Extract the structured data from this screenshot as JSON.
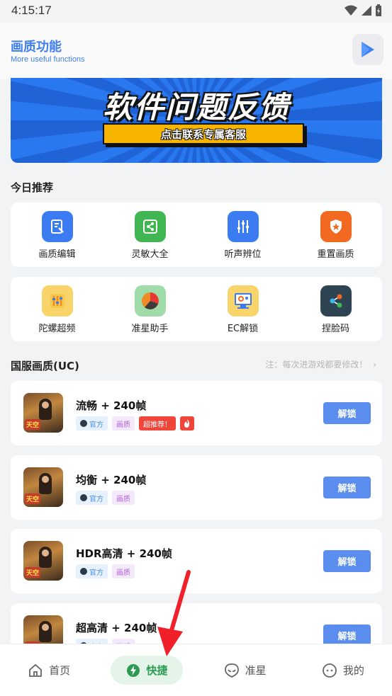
{
  "status": {
    "time": "4:15:17"
  },
  "header": {
    "title": "画质功能",
    "subtitle": "More useful functions"
  },
  "banner": {
    "headline": "软件问题反馈",
    "cta": "点击联系专属客服"
  },
  "today": {
    "title": "今日推荐",
    "row1": [
      {
        "label": "画质编辑",
        "icon": "edit-doc-icon",
        "color": "#3b7cf2"
      },
      {
        "label": "灵敏大全",
        "icon": "share-square-icon",
        "color": "#3fb652"
      },
      {
        "label": "听声辨位",
        "icon": "sliders-icon",
        "color": "#3b7cf2"
      },
      {
        "label": "重置画质",
        "icon": "shield-star-icon",
        "color": "#f26a22"
      }
    ],
    "row2": [
      {
        "label": "陀螺超频",
        "icon": "gyro-bars-icon",
        "color": "#f9d46b"
      },
      {
        "label": "准星助手",
        "icon": "pie-chart-icon",
        "color": "#9fdcaa"
      },
      {
        "label": "EC解锁",
        "icon": "monitor-gear-icon",
        "color": "#f9d46b"
      },
      {
        "label": "捏脸码",
        "icon": "share-nodes-icon",
        "color": "#2e4453"
      }
    ]
  },
  "national": {
    "title": "国服画质(UC)",
    "note": "注：每次进游戏都要修改！"
  },
  "games": [
    {
      "name": "流畅 + 240帧",
      "tag_official": "官方",
      "tag_quality": "画质",
      "tag_hot": "超推荐！",
      "has_fire": true,
      "unlock": "解锁",
      "thumb_badge": "天空"
    },
    {
      "name": "均衡 + 240帧",
      "tag_official": "官方",
      "tag_quality": "画质",
      "unlock": "解锁",
      "thumb_badge": "天空"
    },
    {
      "name": "HDR高清 + 240帧",
      "tag_official": "官方",
      "tag_quality": "画质",
      "unlock": "解锁",
      "thumb_badge": "天空"
    },
    {
      "name": "超高清 + 240帧",
      "tag_official": "官方",
      "tag_quality": "画质",
      "unlock": "解锁",
      "thumb_badge": "天空"
    }
  ],
  "tabs": {
    "home": "首页",
    "quick": "快捷",
    "crosshair": "准星",
    "mine": "我的"
  },
  "colors": {
    "accent": "#3f7ff0",
    "unlock": "#5b8def",
    "active_tab": "#2c9a52",
    "arrow": "#f0202a"
  }
}
